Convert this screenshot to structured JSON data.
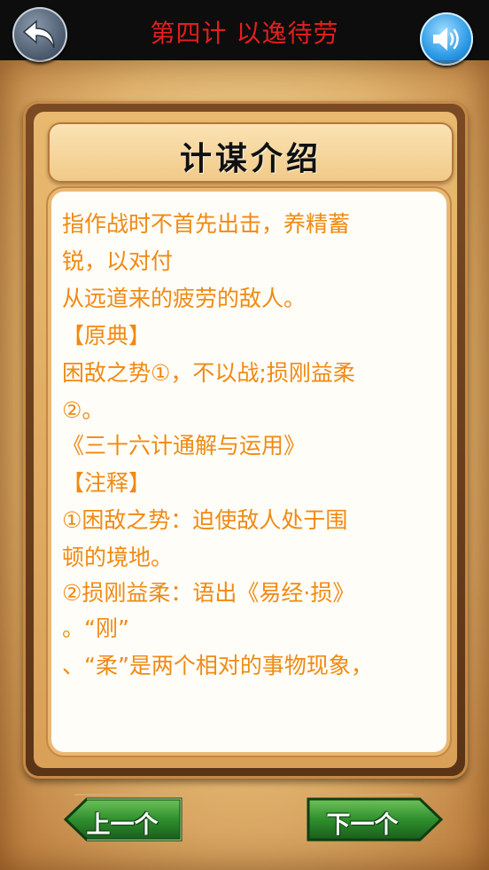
{
  "header": {
    "title": "第四计 以逸待劳",
    "back_icon": "back-arrow-icon",
    "sound_icon": "speaker-icon"
  },
  "panel": {
    "heading": "计谋介绍",
    "lines": [
      "指作战时不首先出击，养精蓄",
      "锐，以对付",
      "从远道来的疲劳的敌人。",
      "【原典】",
      "困敌之势①，不以战;损刚益柔",
      "②。",
      "《三十六计通解与运用》",
      "【注释】",
      "①困敌之势：迫使敌人处于围",
      "顿的境地。",
      "②损刚益柔：语出《易经·损》",
      "。“刚”",
      "、“柔”是两个相对的事物现象，"
    ]
  },
  "nav": {
    "prev_label": "上一个",
    "next_label": "下一个"
  },
  "colors": {
    "title": "#e41e1e",
    "body_text": "#ef8a14",
    "button_green": "#1f7a2a"
  }
}
